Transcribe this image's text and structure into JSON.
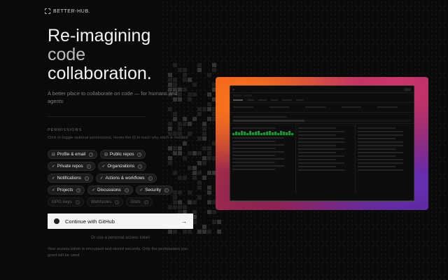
{
  "brand": {
    "name": "BETTER-HUB."
  },
  "hero": {
    "line1": "Re-imagining",
    "line2": "code",
    "line3": "collaboration.",
    "tagline": "A better place to collaborate on code — for humans and agents"
  },
  "permissions": {
    "title": "PERMISSIONS",
    "description": "Click to toggle optional permissions. Hover the (i) to learn why each is needed.",
    "rows": [
      [
        {
          "label": "Profile & email",
          "icon": "lock-icon",
          "enabled": true
        },
        {
          "label": "Public repos",
          "icon": "lock-icon",
          "enabled": true
        }
      ],
      [
        {
          "label": "Private repos",
          "icon": "check-icon",
          "enabled": true
        },
        {
          "label": "Organizations",
          "icon": "check-icon",
          "enabled": true
        }
      ],
      [
        {
          "label": "Notifications",
          "icon": "check-icon",
          "enabled": true
        },
        {
          "label": "Actions & workflows",
          "icon": "check-icon",
          "enabled": true
        }
      ],
      [
        {
          "label": "Projects",
          "icon": "check-icon",
          "enabled": true
        },
        {
          "label": "Discussions",
          "icon": "check-icon",
          "enabled": true
        },
        {
          "label": "Security",
          "icon": "check-icon",
          "enabled": true
        }
      ],
      [
        {
          "label": "GPG keys",
          "icon": "",
          "enabled": false
        },
        {
          "label": "Webhooks",
          "icon": "",
          "enabled": false
        },
        {
          "label": "Gists",
          "icon": "",
          "enabled": false
        }
      ]
    ]
  },
  "auth": {
    "github_button": "Continue with GitHub",
    "alt_link": "Or use a personal access token",
    "footnote": "Your access token is encrypted and stored securely. Only the permissions you grant will be used."
  },
  "colors": {
    "background": "#0a0a0a",
    "button_bg": "#f4f4f4",
    "accent_green": "#1e8f3a"
  }
}
